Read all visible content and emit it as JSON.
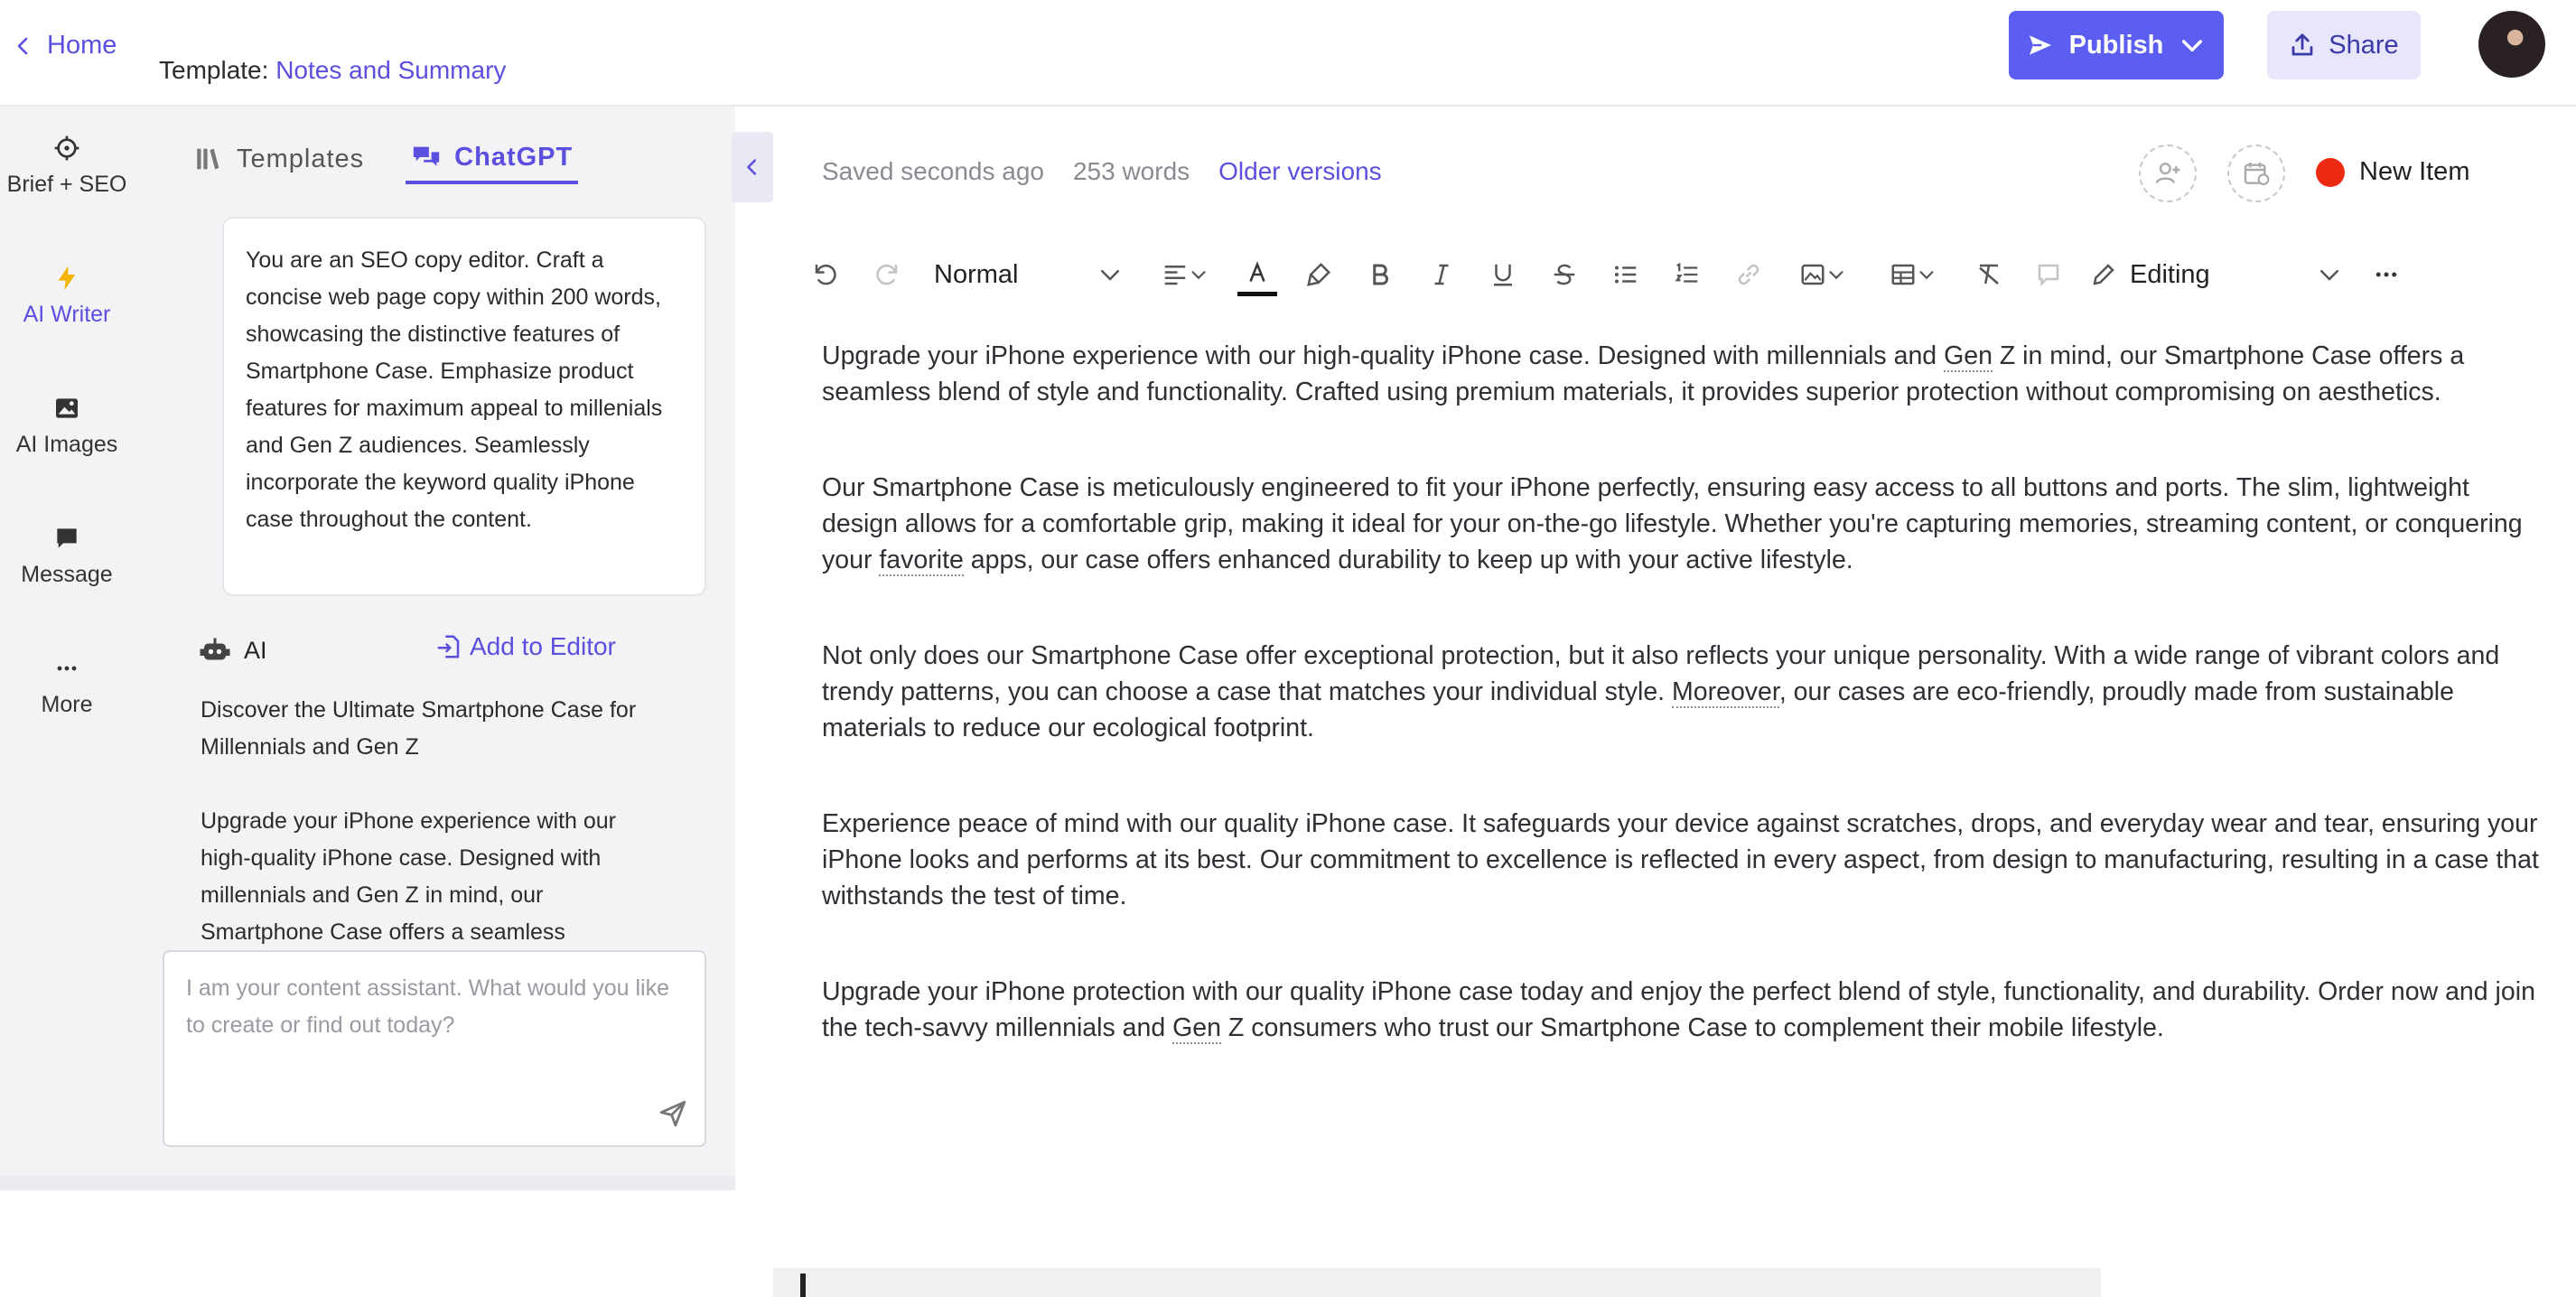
{
  "header": {
    "home_label": "Home",
    "template_prefix": "Template:",
    "template_name": "Notes and Summary",
    "publish_label": "Publish",
    "share_label": "Share"
  },
  "rail": {
    "items": [
      {
        "label": "Brief + SEO",
        "icon": "crosshair-icon"
      },
      {
        "label": "AI Writer",
        "icon": "lightning-icon"
      },
      {
        "label": "AI Images",
        "icon": "image-icon"
      },
      {
        "label": "Message",
        "icon": "chat-bubble-icon"
      },
      {
        "label": "More",
        "icon": "ellipsis-icon"
      }
    ]
  },
  "panel": {
    "tabs": [
      {
        "label": "Templates",
        "icon": "library-icon"
      },
      {
        "label": "ChatGPT",
        "icon": "chat-bubbles-icon"
      }
    ],
    "prompt": "You are an SEO copy editor. Craft a concise web page copy within 200 words, showcasing the distinctive features of Smartphone Case. Emphasize product features for maximum appeal to millenials and Gen Z audiences. Seamlessly incorporate the keyword quality iPhone case throughout the content.",
    "ai_label": "AI",
    "add_to_editor": "Add to Editor",
    "ai_output": [
      "Discover the Ultimate Smartphone Case for Millennials and Gen Z",
      "Upgrade your iPhone experience with our high-quality iPhone case. Designed with millennials and Gen Z in mind, our Smartphone Case offers a seamless"
    ],
    "chat_placeholder": "I am your content assistant. What would you like to create or find out today?"
  },
  "editor": {
    "saved_status": "Saved seconds ago",
    "word_count": "253 words",
    "older_versions": "Older versions",
    "new_item": "New Item",
    "toolbar": {
      "style": "Normal",
      "mode": "Editing"
    },
    "paragraphs": [
      [
        "Upgrade your iPhone experience with our high-quality iPhone case. Designed with millennials and ",
        "Gen",
        " Z in mind, our Smartphone Case offers a seamless blend of style and functionality. Crafted using premium materials, it provides superior protection without compromising on aesthetics."
      ],
      [
        "Our Smartphone Case is meticulously engineered to fit your iPhone perfectly, ensuring easy access to all buttons and ports. The slim, lightweight design allows for a comfortable grip, making it ideal for your on-the-go lifestyle. Whether you're capturing memories, streaming content, or conquering your ",
        "favorite",
        " apps, our case offers enhanced durability to keep up with your active lifestyle."
      ],
      [
        "Not only does our Smartphone Case offer exceptional protection, but it also reflects your unique personality. With a wide range of vibrant colors and trendy patterns, you can choose a case that matches your individual style. ",
        "Moreover",
        ", our cases are eco-friendly, proudly made from sustainable materials to reduce our ecological footprint."
      ],
      [
        "Experience peace of mind with our quality iPhone case. It safeguards your device against scratches, drops, and everyday wear and tear, ensuring your iPhone looks and performs at its best. Our commitment to excellence is reflected in every aspect, from design to manufacturing, resulting in a case that withstands the test of time.",
        "",
        ""
      ],
      [
        "Upgrade your iPhone protection with our quality iPhone case today and enjoy the perfect blend of style, functionality, and durability. Order now and join the tech-savvy millennials and ",
        "Gen",
        " Z consumers who trust our Smartphone Case to complement their mobile lifestyle."
      ]
    ]
  },
  "colors": {
    "accent": "#5b4fe0",
    "publish_bg": "#5b5ef0",
    "share_bg": "#e8e6fb",
    "new_item_dot": "#ec2a12"
  }
}
